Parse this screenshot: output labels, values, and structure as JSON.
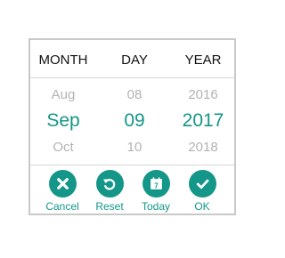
{
  "headers": [
    "MONTH",
    "DAY",
    "YEAR"
  ],
  "wheels": {
    "month": {
      "prev": "Aug",
      "selected": "Sep",
      "next": "Oct"
    },
    "day": {
      "prev": "08",
      "selected": "09",
      "next": "10"
    },
    "year": {
      "prev": "2016",
      "selected": "2017",
      "next": "2018"
    }
  },
  "actions": {
    "cancel": {
      "label": "Cancel",
      "icon": "close-icon"
    },
    "reset": {
      "label": "Reset",
      "icon": "refresh-icon"
    },
    "today": {
      "label": "Today",
      "icon": "calendar-today-icon",
      "icon_text": "7"
    },
    "ok": {
      "label": "OK",
      "icon": "check-icon"
    }
  },
  "colors": {
    "accent": "#149688",
    "muted": "#b3b3b3",
    "border": "#c9c9c9"
  }
}
